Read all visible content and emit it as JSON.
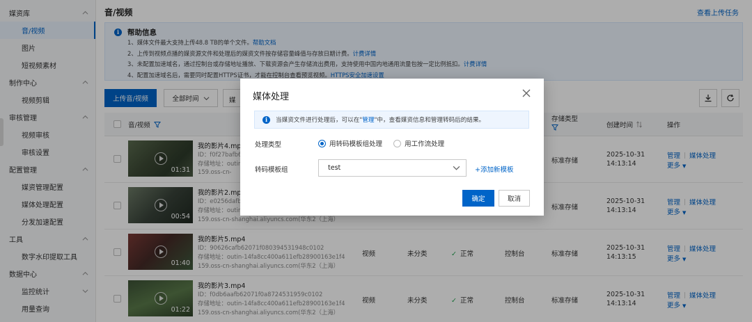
{
  "sidebar": {
    "sections": [
      {
        "title": "媒资库",
        "items": [
          "音/视频",
          "图片",
          "短视频素材"
        ]
      },
      {
        "title": "制作中心",
        "items": [
          "视频剪辑"
        ]
      },
      {
        "title": "审核管理",
        "items": [
          "视频审核",
          "审核设置"
        ]
      },
      {
        "title": "配置管理",
        "items": [
          "媒资管理配置",
          "媒体处理配置",
          "分发加速配置"
        ]
      },
      {
        "title": "工具",
        "items": [
          "数字水印提取工具"
        ]
      },
      {
        "title": "数据中心",
        "items": [
          "监控统计",
          "用量查询"
        ]
      }
    ]
  },
  "header": {
    "title": "音/视频",
    "upload_tasks_link": "查看上传任务"
  },
  "info": {
    "title": "帮助信息",
    "lines": [
      {
        "text": "1、媒体文件最大支持上传48.8 TB的单个文件。",
        "link": "帮助文档"
      },
      {
        "text": "2、上传到视频点播的媒资源文件和处理后的媒资文件按存储容量峰值与存放日期计费。",
        "link": "计费详情"
      },
      {
        "text": "3、未配置加速域名，通过控制台或存储地址播放、下载资源会产生存储流出费用，支持使用中国内地通用流量包按一定比例抵扣。",
        "link": "计费详情"
      },
      {
        "text": "4、配置加速域名后，需要同时配置HTTPS证书，才能在控制台查看预览视频。",
        "link": "HTTPS安全加速设置"
      }
    ]
  },
  "toolbar": {
    "upload_label": "上传音/视频",
    "time_filter": "全部时间",
    "second_filter": "媒"
  },
  "table": {
    "headers": {
      "media": "音/视频",
      "storage_type": "存储类型",
      "created": "创建时间",
      "actions": "操作"
    },
    "rows": [
      {
        "name": "我的影片4.mp4",
        "id": "ID：f0f27bafb6",
        "addr": "存储地址：outin",
        "host": "159.oss-cn-",
        "duration": "01:31",
        "type": "",
        "category": "",
        "status": "",
        "source": "",
        "storage": "标准存储",
        "date": "2025-10-31",
        "time": "14:13:14"
      },
      {
        "name": "我的影片2.mp4",
        "id": "ID：e0256dafb",
        "addr": "存储地址：outin",
        "host": "159.oss-cn-shanghai.aliyuncs.com(华东2（上海）",
        "duration": "00:54",
        "type": "",
        "category": "",
        "status": "",
        "source": "",
        "storage": "标准存储",
        "date": "2025-10-31",
        "time": "14:13:14"
      },
      {
        "name": "我的影片5.mp4",
        "id": "ID：90626cafb62071f080394531948c0102",
        "addr": "存储地址：outin-14fa8cc400a611efb28900163e1f4",
        "host": "159.oss-cn-shanghai.aliyuncs.com(华东2（上海）",
        "duration": "01:40",
        "type": "视频",
        "category": "未分类",
        "status": "正常",
        "source": "控制台",
        "storage": "标准存储",
        "date": "2025-10-31",
        "time": "14:13:15"
      },
      {
        "name": "我的影片3.mp4",
        "id": "ID：f0db6aafb62071f0a8724531959c0102",
        "addr": "存储地址：outin-14fa8cc400a611efb28900163e1f4",
        "host": "159.oss-cn-shanghai.aliyuncs.com(华东2（上海）",
        "duration": "01:22",
        "type": "视频",
        "category": "未分类",
        "status": "正常",
        "source": "控制台",
        "storage": "标准存储",
        "date": "2025-10-31",
        "time": "14:13:14"
      }
    ],
    "actions": {
      "manage": "管理",
      "process": "媒体处理",
      "more": "更多"
    }
  },
  "modal": {
    "title": "媒体处理",
    "tip_prefix": "当媒资文件进行处理后，可以在\"",
    "tip_link": "管理",
    "tip_suffix": "\"中，查看媒资信息和管理转码后的结果。",
    "process_type_label": "处理类型",
    "option_template": "用转码模板组处理",
    "option_workflow": "用工作流处理",
    "template_group_label": "转码模板组",
    "template_value": "test",
    "add_template": "+添加新模板",
    "ok_label": "确定",
    "cancel_label": "取消"
  },
  "colors": {
    "primary": "#0064c8",
    "success": "#1a9f4a",
    "info_bg": "#eef5fe"
  }
}
